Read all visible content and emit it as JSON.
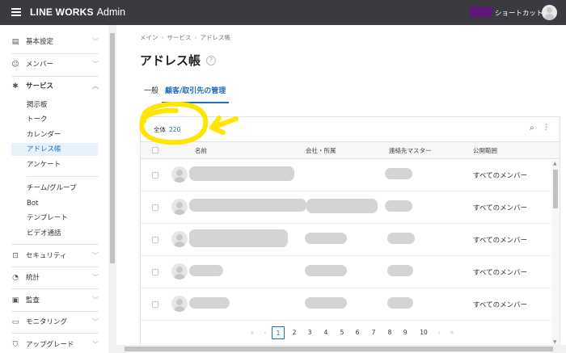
{
  "header": {
    "brand": "LINE WORKS",
    "product": "Admin",
    "shortcut_label": "ショートカット"
  },
  "sidebar": {
    "sections": [
      {
        "label": "基本設定",
        "icon": "settings-panel-icon"
      },
      {
        "label": "メンバー",
        "icon": "users-icon"
      },
      {
        "label": "サービス",
        "icon": "gear-icon",
        "expanded": true
      }
    ],
    "service_items": [
      "掲示板",
      "トーク",
      "カレンダー",
      "アドレス帳",
      "アンケート"
    ],
    "service_items2": [
      "チーム/グループ",
      "Bot",
      "テンプレート",
      "ビデオ通話"
    ],
    "lower_sections": [
      {
        "label": "セキュリティ",
        "icon": "lock-icon"
      },
      {
        "label": "統計",
        "icon": "pie-chart-icon"
      },
      {
        "label": "監査",
        "icon": "document-icon"
      },
      {
        "label": "モニタリング",
        "icon": "monitor-icon"
      },
      {
        "label": "アップグレード",
        "icon": "cart-icon"
      }
    ],
    "active_item": "アドレス帳"
  },
  "main": {
    "breadcrumb": [
      "メイン",
      "サービス",
      "アドレス帳"
    ],
    "title": "アドレス帳",
    "tabs": [
      {
        "label": "一般",
        "active": false
      },
      {
        "label": "顧客/取引先の管理",
        "active": true
      }
    ],
    "total_label": "全体",
    "total_count": "220",
    "table": {
      "columns": [
        "名前",
        "会社・所属",
        "連絡先マスター",
        "公開範囲"
      ],
      "rows": [
        {
          "scope": "すべてのメンバー"
        },
        {
          "scope": "すべてのメンバー"
        },
        {
          "scope": "すべてのメンバー"
        },
        {
          "scope": "すべてのメンバー"
        },
        {
          "scope": "すべてのメンバー"
        }
      ]
    },
    "pagination": {
      "pages": [
        "1",
        "2",
        "3",
        "4",
        "5",
        "6",
        "7",
        "8",
        "9",
        "10"
      ],
      "current": "1"
    }
  },
  "colors": {
    "topbar": "#3a3b40",
    "accent": "#1d6fba",
    "active_bg": "#e6f1fb",
    "annotation": "#ffe500"
  }
}
